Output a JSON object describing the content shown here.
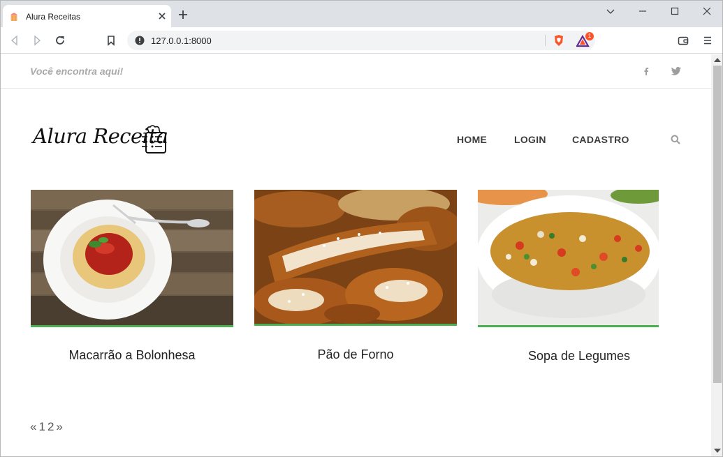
{
  "browser": {
    "tab_title": "Alura Receitas",
    "url": "127.0.0.1:8000",
    "brave_badge_count": "1"
  },
  "site": {
    "tagline": "Você encontra aqui!",
    "logo_text": "Alura Receita",
    "nav": {
      "home": "HOME",
      "login": "LOGIN",
      "cadastro": "CADASTRO"
    },
    "recipes": [
      {
        "title": "Macarrão a Bolonhesa"
      },
      {
        "title": "Pão de Forno"
      },
      {
        "title": "Sopa de Legumes"
      }
    ],
    "pagination": {
      "prev": "«",
      "pages": [
        "1",
        "2"
      ],
      "next": "»"
    }
  },
  "colors": {
    "accent_green": "#4caf50",
    "tabstrip": "#dee1e6",
    "brave_orange": "#fb542b"
  }
}
